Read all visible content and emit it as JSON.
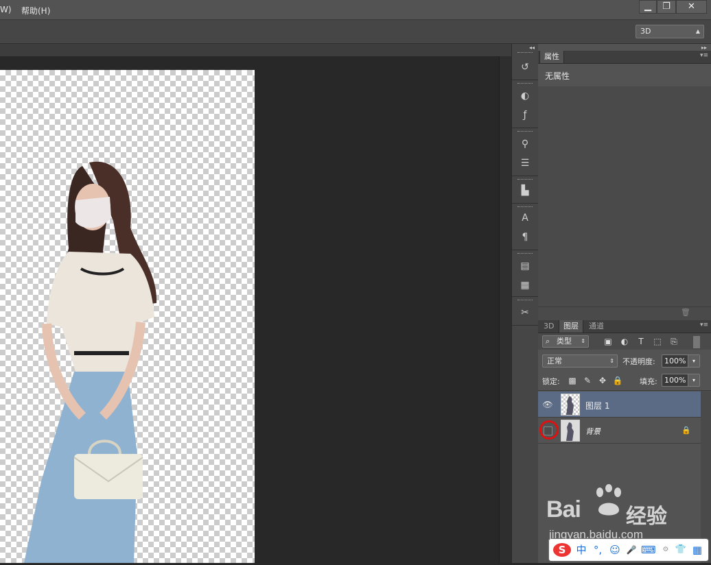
{
  "menubar": {
    "items": [
      "W)",
      "帮助(H)"
    ],
    "window_controls": {
      "minimize": "▁",
      "restore": "❐",
      "close": "✕"
    }
  },
  "options_bar": {
    "workspace_select": "3D"
  },
  "icon_strip": {
    "collapse": "◂◂",
    "icons": [
      "history-icon",
      "color-icon",
      "styles-icon",
      "brush-icon",
      "adjustments-icon",
      "clone-source-icon",
      "character-icon",
      "paragraph-icon",
      "notes-icon",
      "info-icon",
      "tools-preset-icon"
    ]
  },
  "properties_panel": {
    "tab": "属性",
    "body_text": "无属性",
    "expand": "▸▸"
  },
  "layers_panel": {
    "tabs": [
      "3D",
      "图层",
      "通道"
    ],
    "active_tab": "图层",
    "filter_label": "类型",
    "blend_mode": "正常",
    "opacity_label": "不透明度:",
    "opacity_value": "100%",
    "lock_label": "锁定:",
    "fill_label": "填充:",
    "fill_value": "100%",
    "layers": [
      {
        "name": "图层 1",
        "visible": true,
        "selected": true,
        "locked": false
      },
      {
        "name": "背景",
        "visible": false,
        "selected": false,
        "locked": true
      }
    ]
  },
  "watermark": {
    "brand": "Bai",
    "brand_cn": "经验",
    "url": "jingyan.baidu.com"
  },
  "ime_bar": {
    "logo": "S",
    "items": [
      "中",
      "°,",
      "☺",
      "🎤",
      "⌨",
      "👕",
      "▦"
    ]
  },
  "colors": {
    "highlight_ring": "#dd1111",
    "selected_layer": "#5b6b85"
  }
}
